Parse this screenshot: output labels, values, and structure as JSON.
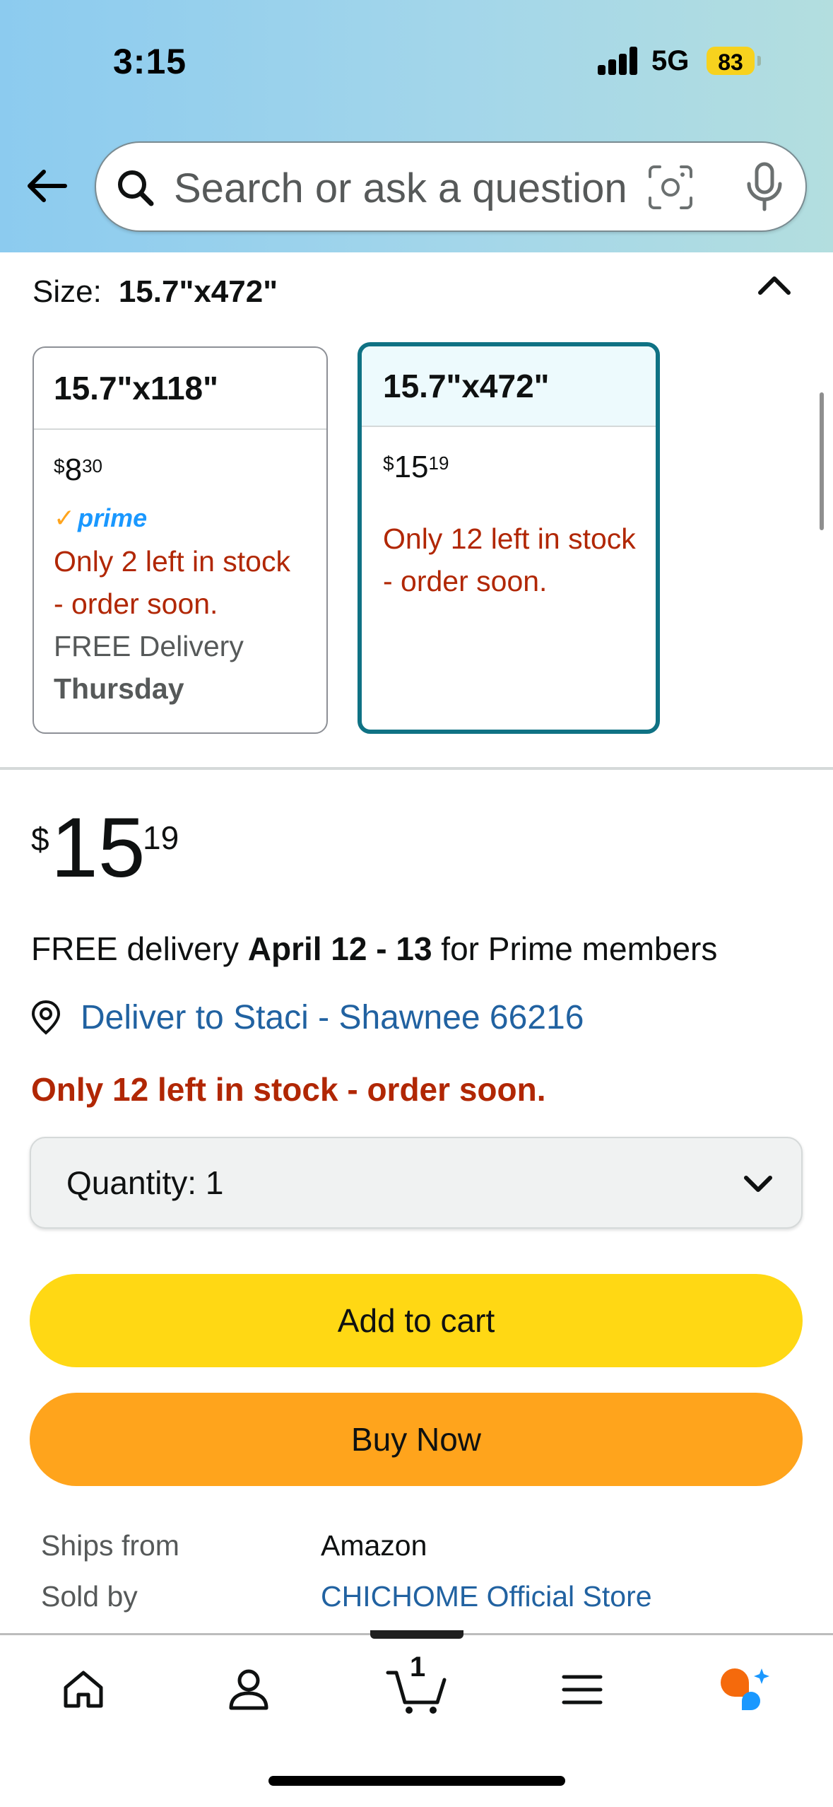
{
  "status_bar": {
    "time": "3:15",
    "network": "5G",
    "battery": "83"
  },
  "search": {
    "placeholder": "Search or ask a question"
  },
  "size_selector": {
    "label": "Size:",
    "selected": "15.7\"x472\"",
    "options": [
      {
        "name": "15.7\"x118\"",
        "price_symbol": "$",
        "price_whole": "8",
        "price_fraction": "30",
        "prime": "prime",
        "stock": "Only 2 left in stock - order soon.",
        "delivery_text": "FREE Delivery",
        "delivery_day": "Thursday"
      },
      {
        "name": "15.7\"x472\"",
        "price_symbol": "$",
        "price_whole": "15",
        "price_fraction": "19",
        "stock": "Only 12 left in stock - order soon."
      }
    ]
  },
  "price": {
    "symbol": "$",
    "whole": "15",
    "fraction": "19"
  },
  "delivery": {
    "prefix": "FREE delivery ",
    "dates": "April 12 - 13",
    "suffix": " for Prime members",
    "location": "Deliver to Staci - Shawnee 66216"
  },
  "stock_message": "Only 12 left in stock - order soon.",
  "quantity": {
    "label": "Quantity:",
    "value": "1"
  },
  "buttons": {
    "add_to_cart": "Add to cart",
    "buy_now": "Buy Now"
  },
  "seller_info": {
    "ships_from_label": "Ships from",
    "ships_from_value": "Amazon",
    "sold_by_label": "Sold by",
    "sold_by_value": "CHICHOME Official Store"
  },
  "bottom_nav": {
    "cart_count": "1",
    "items": [
      "home-icon",
      "account-icon",
      "cart-icon",
      "menu-icon",
      "rufus-assistant-icon"
    ]
  },
  "colors": {
    "add_to_cart": "#ffd814",
    "buy_now": "#ffa41c",
    "stock_red": "#b12704",
    "link_blue": "#2162a1",
    "selected_border": "#0f7284",
    "prime_blue": "#1a98ff"
  }
}
